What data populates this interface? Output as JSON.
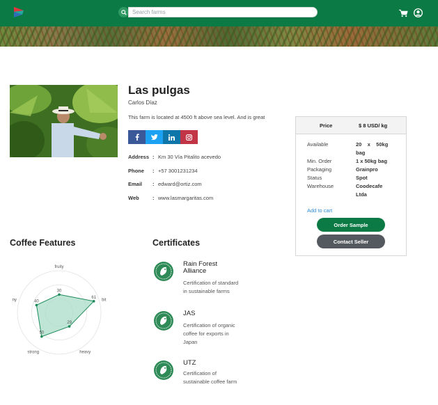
{
  "header": {
    "search_placeholder": "Search farms",
    "brand_colors": {
      "bar": "#0b7a44",
      "logo_red": "#e2343c",
      "logo_teal": "#23a9a0",
      "logo_blue": "#2f6fb5"
    }
  },
  "farm": {
    "name": "Las pulgas",
    "owner": "Carlos Díaz",
    "description": "This farm is located at 4500 ft above sea level. And is great",
    "info": [
      {
        "key": "Address",
        "value": "Km 30 Vía Pitalito acevedo"
      },
      {
        "key": "Phone",
        "value": "+57 3001231234"
      },
      {
        "key": "Email",
        "value": "edward@ortiz.com"
      },
      {
        "key": "Web",
        "value": "www.lasmargaritas.com"
      }
    ]
  },
  "social": [
    "facebook-icon",
    "twitter-icon",
    "linkedin-icon",
    "instagram-icon"
  ],
  "price_card": {
    "price_label": "Price",
    "price_value": "$ 8 USD/ kg",
    "specs": [
      {
        "label": "Available",
        "value_line1": "20    x    50kg",
        "value_line2": "bag"
      },
      {
        "label": "Min. Order",
        "value_line1": "1 x 50kg bag"
      },
      {
        "label": "Packaging",
        "value_line1": "Grainpro"
      },
      {
        "label": "Status",
        "value_line1": "Spot"
      },
      {
        "label": "Warehouse",
        "value_line1": "Coodecafe",
        "value_line2": "Ltda"
      }
    ],
    "add_to_cart": "Add to cart",
    "order_sample": "Order Sample",
    "contact_seller": "Contact Seller"
  },
  "features": {
    "title": "Coffee Features",
    "axes": [
      "fruity",
      "bit",
      "heavy",
      "strong",
      "ny"
    ],
    "values": [
      30,
      61,
      29,
      50,
      40
    ],
    "max": 70,
    "colors": {
      "fill": "#a8dcc8",
      "stroke": "#1e8a5a",
      "grid": "#e2e2e2"
    }
  },
  "certificates": {
    "title": "Certificates",
    "items": [
      {
        "name": "Rain Forest Alliance",
        "desc_lines": [
          "Certification of standard",
          "in sustainable farms"
        ]
      },
      {
        "name": "JAS",
        "desc_lines": [
          "Certification of organic",
          "coffee for exports in",
          "Japan"
        ]
      },
      {
        "name": "UTZ",
        "desc_lines": [
          "Certification of",
          "sustainable coffee farm"
        ]
      }
    ]
  }
}
